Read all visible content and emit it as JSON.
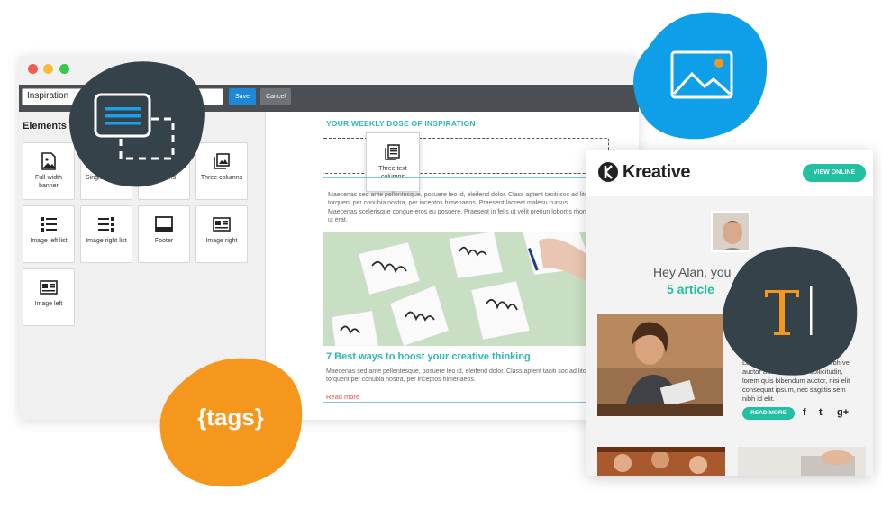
{
  "editor": {
    "name_value": "Inspiration",
    "save_label": "Save",
    "cancel_label": "Cancel",
    "elements_title": "Elements",
    "tiles": [
      {
        "label": "Full-width banner",
        "icon": "image-icon"
      },
      {
        "label": "Single text row",
        "icon": "text-row-icon"
      },
      {
        "label": "columns",
        "icon": "columns-icon"
      },
      {
        "label": "Three columns",
        "icon": "gallery-icon"
      },
      {
        "label": "Image left list",
        "icon": "list-left-icon"
      },
      {
        "label": "Image right list",
        "icon": "list-right-icon"
      },
      {
        "label": "Footer",
        "icon": "footer-icon"
      },
      {
        "label": "Image right",
        "icon": "article-icon"
      },
      {
        "label": "Image left",
        "icon": "article-left-icon"
      }
    ],
    "canvas": {
      "weekly_heading": "YOUR WEEKLY DOSE OF INSPIRATION",
      "drag_tile_label": "Three text columns",
      "paragraph1": "Maecenas sed ante pellentesque, posuere leo id, eleifend dolor. Class aptent taciti soc ad litora torquent per conubia nostra, per inceptos himenaeos. Praesent laoreet malesu cursus. Maecenas scelerisque congue eros eu posuere. Praesent in felis ut velit pretiun lobortis rhoncus ut erat.",
      "headline": "7 Best ways to boost your creative thinking",
      "paragraph2": "Maecenas sed ante pellentesque, posuere leo id, eleifend dolor. Class aptent taciti soc ad litora torquent per conubia nostra, per inceptos himenaeos.",
      "read_more": "Read more"
    }
  },
  "email": {
    "brand": "Kreative",
    "view_online": "VIEW ONLINE",
    "greeting": "Hey Alan, you",
    "articles": "5 article",
    "right_text": "Lorem ipsum dolor sit amet, nibh vel auctor auctor. Aenean sollicitudin, lorem quis bibendum auctor, nisi elit consequat ipsum, nec sagittis sem nibh id elit.",
    "read_more_btn": "READ MORE",
    "social": [
      "f",
      "t",
      "g+"
    ]
  },
  "tags_label": "{tags}",
  "colors": {
    "teal": "#20c0a0",
    "dark_blob": "#36424a",
    "blue_blob": "#0f9ee8",
    "orange_blob": "#f5971d",
    "accent_text": "#2db7b3"
  }
}
